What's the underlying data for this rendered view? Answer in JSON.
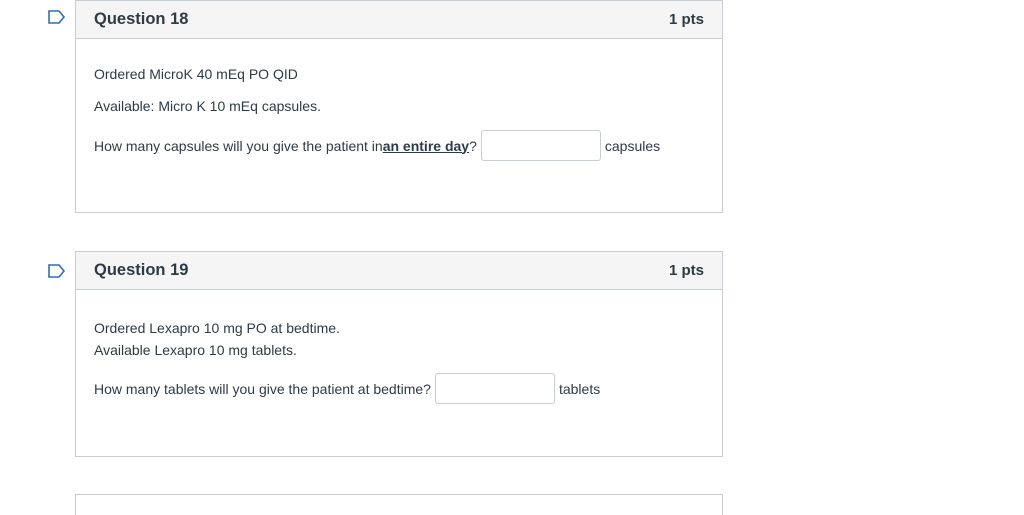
{
  "questions": [
    {
      "title": "Question 18",
      "points": "1 pts",
      "lines": [
        "Ordered MicroK 40 mEq PO QID",
        "Available: Micro K 10 mEq capsules."
      ],
      "prompt_before": "How many capsules will you give the patient in",
      "prompt_emphasis": " an entire day",
      "prompt_after": "?",
      "answer_value": "",
      "unit": "capsules"
    },
    {
      "title": "Question 19",
      "points": "1 pts",
      "lines": [
        "Ordered Lexapro 10 mg PO at bedtime.",
        "Available Lexapro 10 mg tablets."
      ],
      "prompt_before": "How many tablets will you give the patient at bedtime?",
      "answer_value": "",
      "unit": "tablets"
    }
  ],
  "colors": {
    "header_bg": "#f5f5f5",
    "border": "#c7cdd1",
    "text": "#2d3b45",
    "flag": "#2d6fb5"
  },
  "icons": {
    "flag": "bookmark-flag-icon"
  }
}
